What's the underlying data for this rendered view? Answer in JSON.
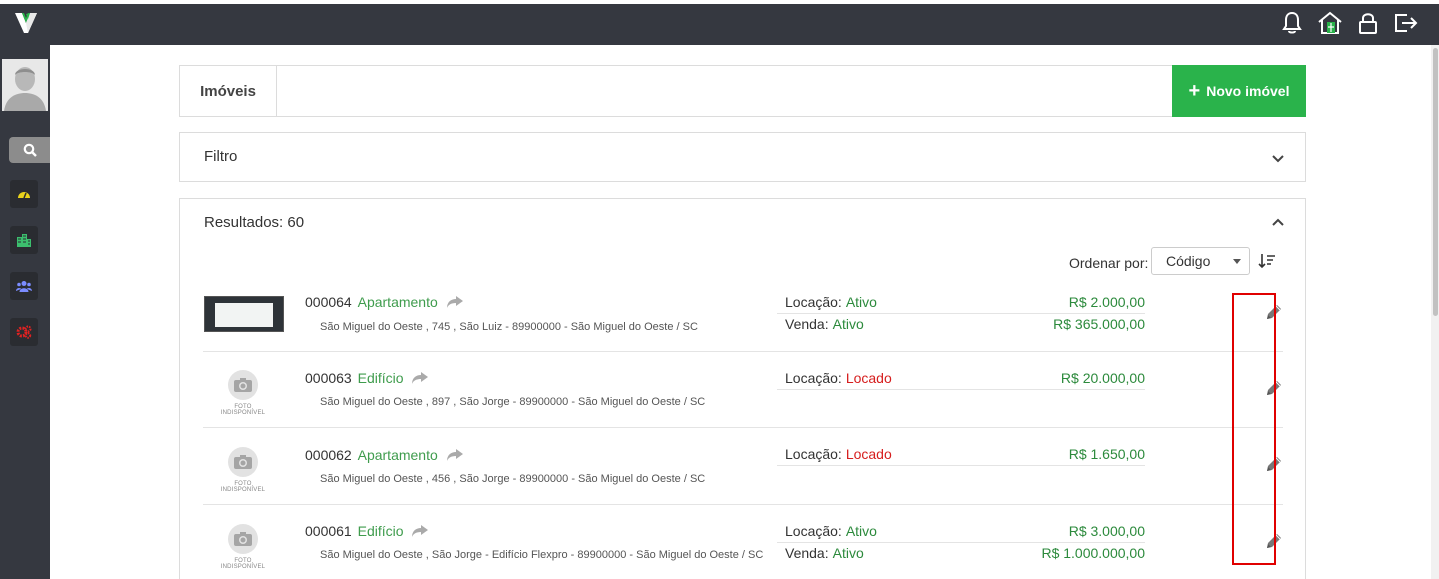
{
  "header": {
    "title": "Imóveis",
    "new_button": "Novo imóvel"
  },
  "filter": {
    "label": "Filtro"
  },
  "results": {
    "label": "Resultados: 60",
    "sort_label": "Ordenar por:",
    "sort_value": "Código"
  },
  "no_photo_text": "FOTO INDISPONÍVEL",
  "listings": [
    {
      "code": "000064",
      "type": "Apartamento",
      "address": "São Miguel do Oeste , 745 , São Luiz - 89900000 - São Miguel do Oeste / SC",
      "has_photo": true,
      "deals": [
        {
          "label": "Locação:",
          "status": "Ativo",
          "status_color": "green",
          "price": "R$ 2.000,00"
        },
        {
          "label": "Venda:",
          "status": "Ativo",
          "status_color": "green",
          "price": "R$ 365.000,00"
        }
      ]
    },
    {
      "code": "000063",
      "type": "Edifício",
      "address": "São Miguel do Oeste , 897 , São Jorge - 89900000 - São Miguel do Oeste / SC",
      "has_photo": false,
      "deals": [
        {
          "label": "Locação:",
          "status": "Locado",
          "status_color": "red",
          "price": "R$ 20.000,00"
        }
      ]
    },
    {
      "code": "000062",
      "type": "Apartamento",
      "address": "São Miguel do Oeste , 456 , São Jorge - 89900000 - São Miguel do Oeste / SC",
      "has_photo": false,
      "deals": [
        {
          "label": "Locação:",
          "status": "Locado",
          "status_color": "red",
          "price": "R$ 1.650,00"
        }
      ]
    },
    {
      "code": "000061",
      "type": "Edifício",
      "address": "São Miguel do Oeste , São Jorge - Edifício Flexpro - 89900000 - São Miguel do Oeste / SC",
      "has_photo": false,
      "deals": [
        {
          "label": "Locação:",
          "status": "Ativo",
          "status_color": "green",
          "price": "R$ 3.000,00"
        },
        {
          "label": "Venda:",
          "status": "Ativo",
          "status_color": "green",
          "price": "R$ 1.000.000,00"
        }
      ]
    }
  ],
  "colors": {
    "topbar": "#353840",
    "accent_green": "#2ab34b",
    "status_green": "#2c8a3c",
    "status_red": "#d61e1e",
    "highlight_box": "#e00000"
  },
  "icons": {
    "top": [
      "bell-icon",
      "home-icon",
      "lock-icon",
      "logout-icon"
    ],
    "sidebar": [
      "search-icon",
      "dashboard-icon",
      "buildings-icon",
      "users-icon",
      "settings-icon"
    ]
  }
}
